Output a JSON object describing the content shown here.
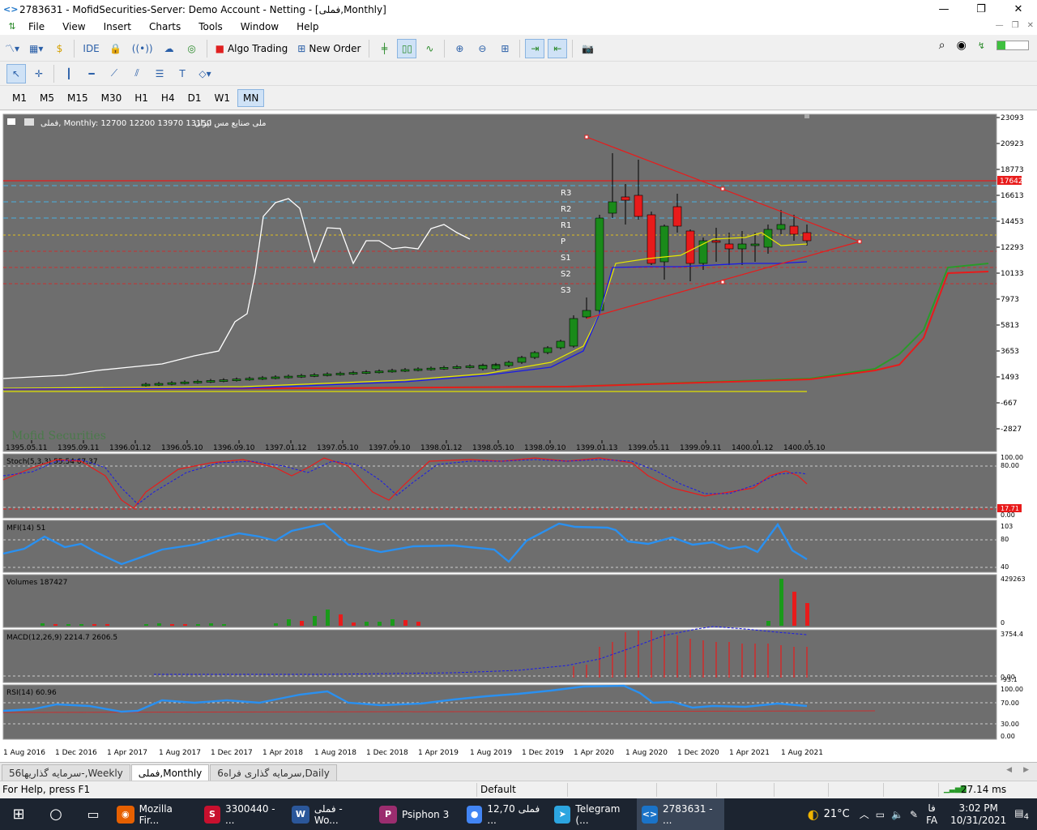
{
  "titlebar": {
    "title": "2783631 - MofidSecurities-Server: Demo Account - Netting - [فملی,Monthly]",
    "minimize": "—",
    "restore": "❐",
    "close": "✕"
  },
  "menu": [
    "File",
    "View",
    "Insert",
    "Charts",
    "Tools",
    "Window",
    "Help"
  ],
  "toolbar": {
    "ide": "IDE",
    "algo": "Algo Trading",
    "new_order": "New Order"
  },
  "timeframes": [
    "M1",
    "M5",
    "M15",
    "M30",
    "H1",
    "H4",
    "D1",
    "W1",
    "MN"
  ],
  "active_timeframe": "MN",
  "chart": {
    "info": "فملی, Monthly:  12700 12200 13970 13150",
    "info_rtl": "ملی صنایع مس ایران",
    "watermark": "Mofid Securities",
    "price_ticks": [
      "23093",
      "20923",
      "18773",
      "16613",
      "14453",
      "12293",
      "10133",
      "7973",
      "5813",
      "3653",
      "1493",
      "-667",
      "-2827"
    ],
    "price_label": "17642",
    "pivot_labels": [
      "R3",
      "R2",
      "R1",
      "P",
      "S1",
      "S2",
      "S3"
    ],
    "top_dates": [
      "1395.05.11",
      "1395.09.11",
      "1396.01.12",
      "1396.05.10",
      "1396.09.10",
      "1397.01.12",
      "1397.05.10",
      "1397.09.10",
      "1398.01.12",
      "1398.05.10",
      "1398.09.10",
      "1399.01.13",
      "1399.05.11",
      "1399.09.11",
      "1400.01.12",
      "1400.05.10"
    ],
    "bottom_dates": [
      "1 Aug 2016",
      "1 Dec 2016",
      "1 Apr 2017",
      "1 Aug 2017",
      "1 Dec 2017",
      "1 Apr 2018",
      "1 Aug 2018",
      "1 Dec 2018",
      "1 Apr 2019",
      "1 Aug 2019",
      "1 Dec 2019",
      "1 Apr 2020",
      "1 Aug 2020",
      "1 Dec 2020",
      "1 Apr 2021",
      "1 Aug 2021"
    ]
  },
  "indicators": {
    "stoch": {
      "label": "Stoch(5,3,3) 55.54 67.37",
      "ticks": [
        "100.00",
        "80.00",
        "17.71",
        "0.00"
      ]
    },
    "mfi": {
      "label": "MFI(14) 51",
      "ticks": [
        "103",
        "80",
        "40"
      ]
    },
    "volumes": {
      "label": "Volumes 187427",
      "ticks": [
        "429263",
        "0"
      ]
    },
    "macd": {
      "label": "MACD(12,26,9) 2214.7 2606.5",
      "ticks": [
        "3754.4",
        "0.00",
        "-93.1"
      ]
    },
    "rsi": {
      "label": "RSI(14) 60.96",
      "ticks": [
        "100.00",
        "70.00",
        "30.00",
        "0.00"
      ]
    }
  },
  "tabs": [
    "سرمایه گذاریها56-,Weekly",
    "فملی,Monthly",
    "سرمایه گذاری فراه6,Daily"
  ],
  "active_tab": "فملی,Monthly",
  "status": {
    "help": "For Help, press F1",
    "profile": "Default",
    "ping": "27.14 ms"
  },
  "taskbar": {
    "apps": [
      {
        "label": "Mozilla Fir...",
        "color": "#e66000",
        "glyph": "◉"
      },
      {
        "label": "3300440 - ...",
        "color": "#c8102e",
        "glyph": "S"
      },
      {
        "label": "فملی - Wo...",
        "color": "#2b579a",
        "glyph": "W"
      },
      {
        "label": "Psiphon 3",
        "color": "#9b2d6f",
        "glyph": "P"
      },
      {
        "label": "فملی 12,70 ...",
        "color": "#4285f4",
        "glyph": "●"
      },
      {
        "label": "Telegram (...",
        "color": "#2ca5e0",
        "glyph": "➤"
      },
      {
        "label": "2783631 - ...",
        "color": "#1a73c8",
        "glyph": "<>"
      }
    ],
    "temp": "21°C",
    "lang": "FA",
    "lang_fa": "فا",
    "time": "3:02 PM",
    "date": "10/31/2021",
    "notif": "4"
  }
}
